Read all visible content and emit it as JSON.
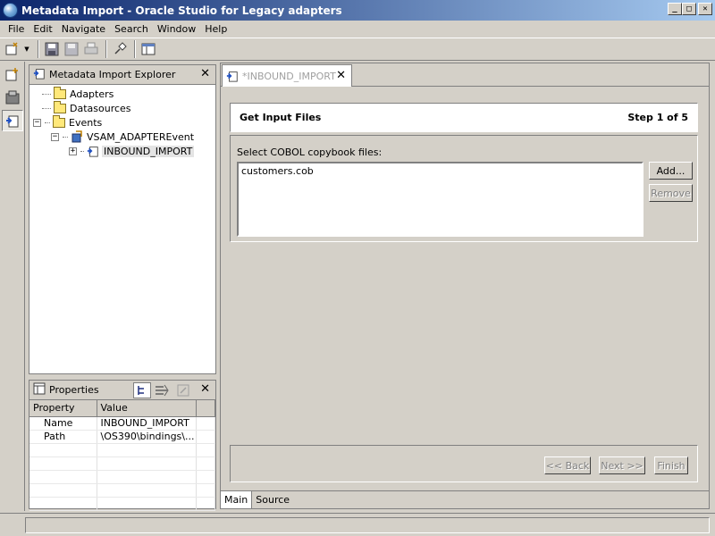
{
  "window": {
    "title": "Metadata Import - Oracle Studio for Legacy adapters",
    "minimize_glyph": "_",
    "maximize_glyph": "□",
    "close_glyph": "✕"
  },
  "menu": [
    "File",
    "Edit",
    "Navigate",
    "Search",
    "Window",
    "Help"
  ],
  "explorer": {
    "title": "Metadata Import Explorer",
    "tree": {
      "adapters": "Adapters",
      "datasources": "Datasources",
      "events": "Events",
      "event_child": "VSAM_ADAPTEREvent",
      "import_node": "INBOUND_IMPORT"
    }
  },
  "properties": {
    "title": "Properties",
    "columns": [
      "Property",
      "Value"
    ],
    "rows": [
      {
        "name": "Name",
        "value": "INBOUND_IMPORT"
      },
      {
        "name": "Path",
        "value": "\\OS390\\bindings\\..."
      }
    ]
  },
  "editor": {
    "tab_title": "*INBOUND_IMPORT",
    "header_title": "Get Input Files",
    "step": "Step 1 of 5",
    "group_label": "Select COBOL copybook files:",
    "files": [
      "customers.cob"
    ],
    "add_button": "Add...",
    "remove_button": "Remove",
    "back_button": "<< Back",
    "next_button": "Next >>",
    "finish_button": "Finish",
    "bottom_tabs": [
      "Main",
      "Source"
    ]
  },
  "colors": {
    "title_bar_start": "#0a246a",
    "title_bar_end": "#a6caf0",
    "window_face": "#d4d0c8",
    "disabled_text": "#808080"
  }
}
